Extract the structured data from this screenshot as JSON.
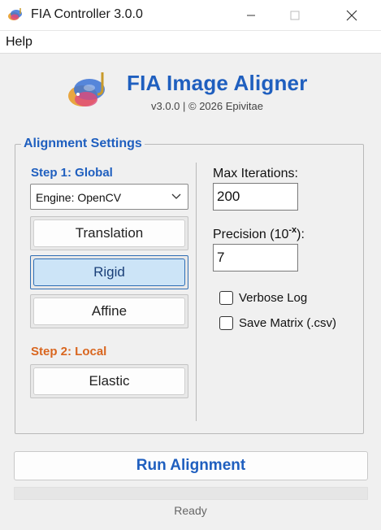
{
  "window": {
    "title": "FIA Controller 3.0.0",
    "minimize_icon": "minimize-icon",
    "maximize_icon": "maximize-icon",
    "close_icon": "close-icon"
  },
  "menu": {
    "items": [
      {
        "label": "Help"
      }
    ]
  },
  "header": {
    "title": "FIA Image Aligner",
    "subtitle": "v3.0.0 | © 2026 Epivitae",
    "logo_icon": "app-logo-icon"
  },
  "alignment": {
    "group_label": "Alignment Settings",
    "step1_label": "Step 1: Global",
    "engine_select": {
      "value": "Engine: OpenCV"
    },
    "buttons": {
      "translation": "Translation",
      "rigid": "Rigid",
      "affine": "Affine"
    },
    "selected_mode": "Rigid",
    "step2_label": "Step 2: Local",
    "elastic_label": "Elastic",
    "max_iterations": {
      "label": "Max Iterations:",
      "value": "200"
    },
    "precision": {
      "label_prefix": "Precision (10",
      "label_sup": "-x",
      "label_suffix": "):",
      "value": "7"
    },
    "verbose_log": {
      "label": "Verbose Log",
      "checked": false
    },
    "save_matrix": {
      "label": "Save Matrix (.csv)",
      "checked": false
    }
  },
  "run_button": {
    "label": "Run Alignment"
  },
  "progress": {
    "fraction": 0
  },
  "status": {
    "text": "Ready"
  },
  "colors": {
    "accent_blue": "#1f5fbf",
    "step2_orange": "#d9661f",
    "selected_bg": "#cce4f7",
    "selected_border": "#2f6eb5"
  }
}
